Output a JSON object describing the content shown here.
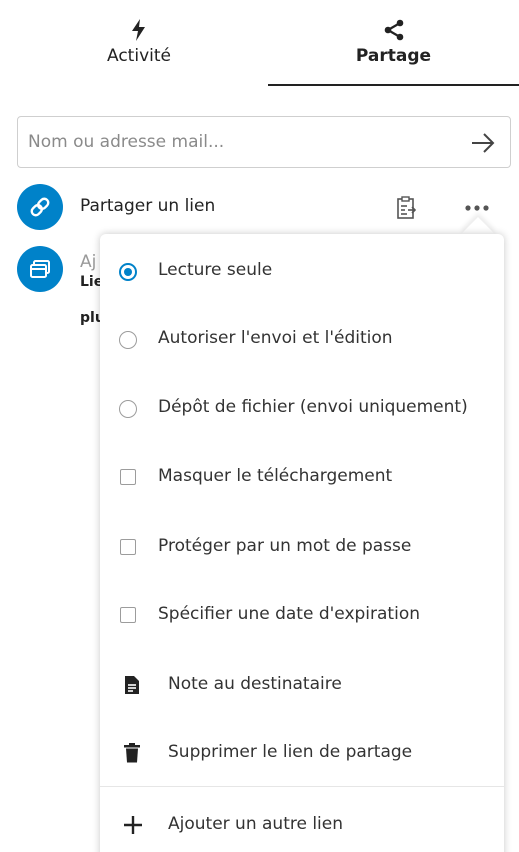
{
  "tabs": [
    {
      "label": "Activité",
      "icon": "lightning-icon",
      "active": false
    },
    {
      "label": "Partage",
      "icon": "share-icon",
      "active": true
    }
  ],
  "search": {
    "placeholder": "Nom ou adresse mail..."
  },
  "share_link_row": {
    "label": "Partager un lien"
  },
  "group_row": {
    "text_partial_1": "Aj",
    "text_partial_2": "Lie",
    "text_partial_3": "plu"
  },
  "menu": {
    "items": [
      {
        "type": "radio",
        "label": "Lecture seule",
        "checked": true
      },
      {
        "type": "radio",
        "label": "Autoriser l'envoi et l'édition",
        "checked": false
      },
      {
        "type": "radio",
        "label": "Dépôt de fichier (envoi uniquement)",
        "checked": false
      },
      {
        "type": "checkbox",
        "label": "Masquer le téléchargement",
        "checked": false
      },
      {
        "type": "checkbox",
        "label": "Protéger par un mot de passe",
        "checked": false
      },
      {
        "type": "checkbox",
        "label": "Spécifier une date d'expiration",
        "checked": false
      },
      {
        "type": "action",
        "label": "Note au destinataire",
        "icon": "note-icon"
      },
      {
        "type": "action",
        "label": "Supprimer le lien de partage",
        "icon": "trash-icon"
      },
      {
        "type": "action",
        "label": "Ajouter un autre lien",
        "icon": "plus-icon"
      }
    ]
  },
  "colors": {
    "accent": "#0082c9"
  }
}
